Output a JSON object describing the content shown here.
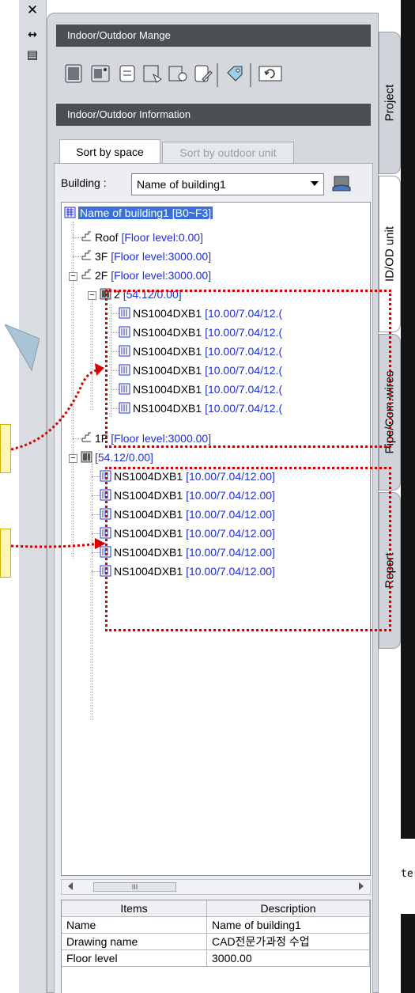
{
  "left_toolbar": {
    "close": "✕",
    "autohide": "↔",
    "properties": "▤"
  },
  "palette": {
    "section_manage": "Indoor/Outdoor Mange",
    "section_info": "Indoor/Outdoor Information",
    "tabs": {
      "space": "Sort by space",
      "outdoor": "Sort by outdoor unit"
    },
    "building_label": "Building :",
    "building_selected": "Name of building1"
  },
  "tree": {
    "root": {
      "name": "Name of building1 [B0~F3]"
    },
    "roof": {
      "name": "Roof",
      "info": "[Floor level:0.00]"
    },
    "f3": {
      "name": "3F",
      "info": "[Floor level:3000.00]"
    },
    "f2": {
      "name": "2F",
      "info": "[Floor level:3000.00]"
    },
    "group2": {
      "name": "2",
      "info": "[54.12/0.00]"
    },
    "group2_units": [
      {
        "name": "NS1004DXB1",
        "info": "[10.00/7.04/12.("
      },
      {
        "name": "NS1004DXB1",
        "info": "[10.00/7.04/12.("
      },
      {
        "name": "NS1004DXB1",
        "info": "[10.00/7.04/12.("
      },
      {
        "name": "NS1004DXB1",
        "info": "[10.00/7.04/12.("
      },
      {
        "name": "NS1004DXB1",
        "info": "[10.00/7.04/12.("
      },
      {
        "name": "NS1004DXB1",
        "info": "[10.00/7.04/12.("
      }
    ],
    "f1": {
      "name": "1F",
      "info": "[Floor level:3000.00]"
    },
    "group1": {
      "name": "",
      "info": "[54.12/0.00]"
    },
    "group1_units": [
      {
        "name": "NS1004DXB1",
        "info": "[10.00/7.04/12.00]"
      },
      {
        "name": "NS1004DXB1",
        "info": "[10.00/7.04/12.00]"
      },
      {
        "name": "NS1004DXB1",
        "info": "[10.00/7.04/12.00]"
      },
      {
        "name": "NS1004DXB1",
        "info": "[10.00/7.04/12.00]"
      },
      {
        "name": "NS1004DXB1",
        "info": "[10.00/7.04/12.00]"
      },
      {
        "name": "NS1004DXB1",
        "info": "[10.00/7.04/12.00]"
      }
    ]
  },
  "scrollbar": {
    "thumb_grip": "III"
  },
  "props": {
    "headers": {
      "items": "Items",
      "description": "Description"
    },
    "rows": [
      {
        "item": "Name",
        "value": "Name of building1"
      },
      {
        "item": "Drawing name",
        "value": "CAD전문가과정  수업"
      },
      {
        "item": "Floor level",
        "value": "3000.00"
      }
    ]
  },
  "side_tabs": {
    "project": "Project",
    "idod": "ID/OD unit",
    "pipe": "Pipe/Com.wires",
    "report": "Report"
  },
  "cad_strip": {
    "text": "ter"
  },
  "colors": {
    "accent_red": "#d40000",
    "tree_blue": "#1f2fd6",
    "header_dark": "#4b4e53"
  }
}
